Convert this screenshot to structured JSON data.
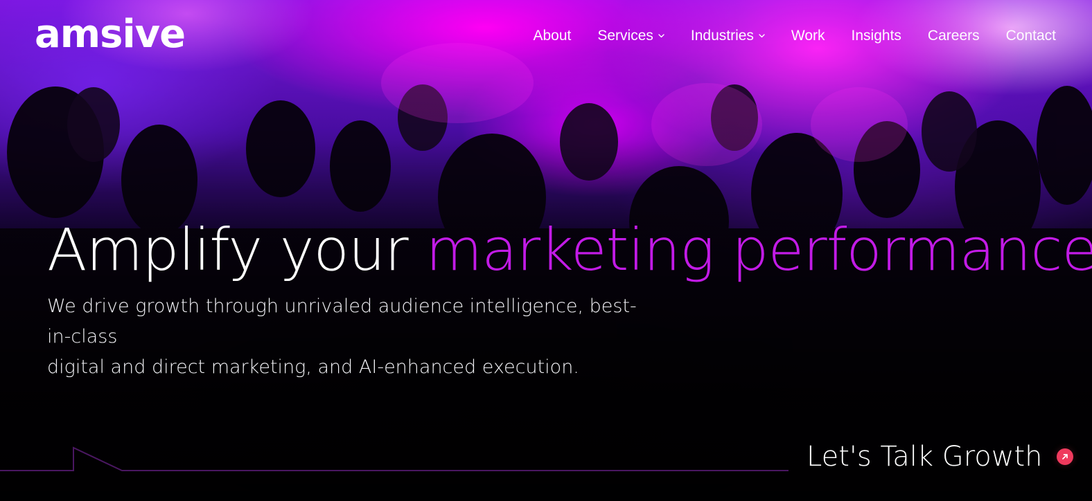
{
  "brand": {
    "logo_text": "amsive",
    "accent_color": "#c21be6",
    "cta_icon_color": "#ef3a5d"
  },
  "nav": {
    "items": [
      {
        "label": "About"
      },
      {
        "label": "Services"
      },
      {
        "label": "Industries"
      },
      {
        "label": "Work"
      },
      {
        "label": "Insights"
      },
      {
        "label": "Careers"
      },
      {
        "label": "Contact"
      }
    ]
  },
  "hero": {
    "headline_white": "Amplify your",
    "headline_accent": "marketing performance.",
    "subtext_line1": "We drive growth through unrivaled audience intelligence, best-in-class",
    "subtext_line2": "digital and direct marketing, and AI-enhanced execution."
  },
  "cta": {
    "label": "Let's Talk Growth",
    "icon": "arrow-up-right-icon"
  }
}
